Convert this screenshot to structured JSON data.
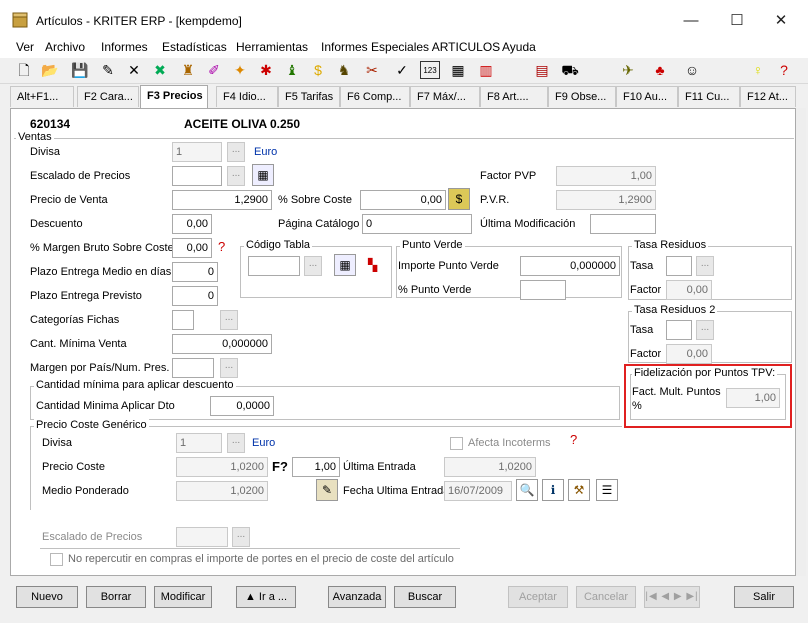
{
  "window": {
    "title": "Artículos - KRITER ERP - [kempdemo]"
  },
  "menu": [
    "Ver",
    "Archivo",
    "Informes",
    "Estadísticas",
    "Herramientas",
    "Informes Especiales ARTICULOS",
    "Ayuda"
  ],
  "tabs": [
    "Alt+F1...",
    "F2 Cara...",
    "F3 Precios",
    "F4 Idio...",
    "F5 Tarifas",
    "F6 Comp...",
    "F7 Máx/...",
    "F8 Art....",
    "F9 Obse...",
    "F10 Au...",
    "F11 Cu...",
    "F12 At..."
  ],
  "article": {
    "code": "620134",
    "name": "ACEITE OLIVA 0.250"
  },
  "ventas": {
    "group_title": "Ventas",
    "divisa_label": "Divisa",
    "divisa_value": "1",
    "divisa_name": "Euro",
    "escalado_label": "Escalado de Precios",
    "precio_venta_label": "Precio de Venta",
    "precio_venta_value": "1,2900",
    "sobre_coste_label": "% Sobre Coste",
    "sobre_coste_value": "0,00",
    "descuento_label": "Descuento",
    "descuento_value": "0,00",
    "pagina_catalogo_label": "Página Catálogo",
    "pagina_catalogo_value": "0",
    "ultima_modificacion_label": "Última Modificación",
    "margen_label": "% Margen Bruto Sobre Coste",
    "margen_value": "0,00",
    "plazo_medio_label": "Plazo Entrega Medio en días",
    "plazo_medio_value": "0",
    "plazo_previsto_label": "Plazo Entrega Previsto",
    "plazo_previsto_value": "0",
    "categorias_label": "Categorías Fichas",
    "cant_minima_label": "Cant. Mínima Venta",
    "cant_minima_value": "0,000000",
    "margen_pais_label": "Margen por País/Num. Pres.",
    "factor_pvp_label": "Factor PVP",
    "factor_pvp_value": "1,00",
    "pvr_label": "P.V.R.",
    "pvr_value": "1,2900"
  },
  "codigo_tabla": {
    "title": "Código Tabla"
  },
  "punto_verde": {
    "title": "Punto Verde",
    "importe_label": "Importe Punto Verde",
    "importe_value": "0,000000",
    "pct_label": "% Punto Verde"
  },
  "tasa1": {
    "title": "Tasa Residuos",
    "tasa_label": "Tasa",
    "factor_label": "Factor",
    "factor_value": "0,00"
  },
  "tasa2": {
    "title": "Tasa Residuos 2",
    "tasa_label": "Tasa",
    "factor_label": "Factor",
    "factor_value": "0,00"
  },
  "fidelizacion": {
    "title": "Fidelización por Puntos TPV:",
    "label1": "Fact. Mult. Puntos",
    "label2": "%",
    "value": "1,00"
  },
  "cantidad_minima": {
    "title": "Cantidad mínima para aplicar descuento",
    "label": "Cantidad Minima Aplicar Dto",
    "value": "0,0000"
  },
  "coste": {
    "title": "Precio Coste Genérico",
    "divisa_label": "Divisa",
    "divisa_value": "1",
    "divisa_name": "Euro",
    "afecta_label": "Afecta Incoterms",
    "precio_coste_label": "Precio Coste",
    "precio_coste_value": "1,0200",
    "factor_label": "F?",
    "factor_value": "1,00",
    "ultima_entrada_label": "Última Entrada",
    "ultima_entrada_value": "1,0200",
    "medio_label": "Medio Ponderado",
    "medio_value": "1,0200",
    "fecha_label": "Fecha Ultima Entrada",
    "fecha_value": "16/07/2009",
    "escalado_label": "Escalado de Precios",
    "no_repercutir_label": "No repercutir en compras el importe de portes en el precio de coste del artículo"
  },
  "buttons": {
    "nuevo": "Nuevo",
    "borrar": "Borrar",
    "modificar": "Modificar",
    "ir_a": "▲ Ir a ...",
    "avanzada": "Avanzada",
    "buscar": "Buscar",
    "aceptar": "Aceptar",
    "cancelar": "Cancelar",
    "salir": "Salir"
  },
  "colors": {
    "highlight": "#e02020",
    "link": "#0033aa"
  }
}
